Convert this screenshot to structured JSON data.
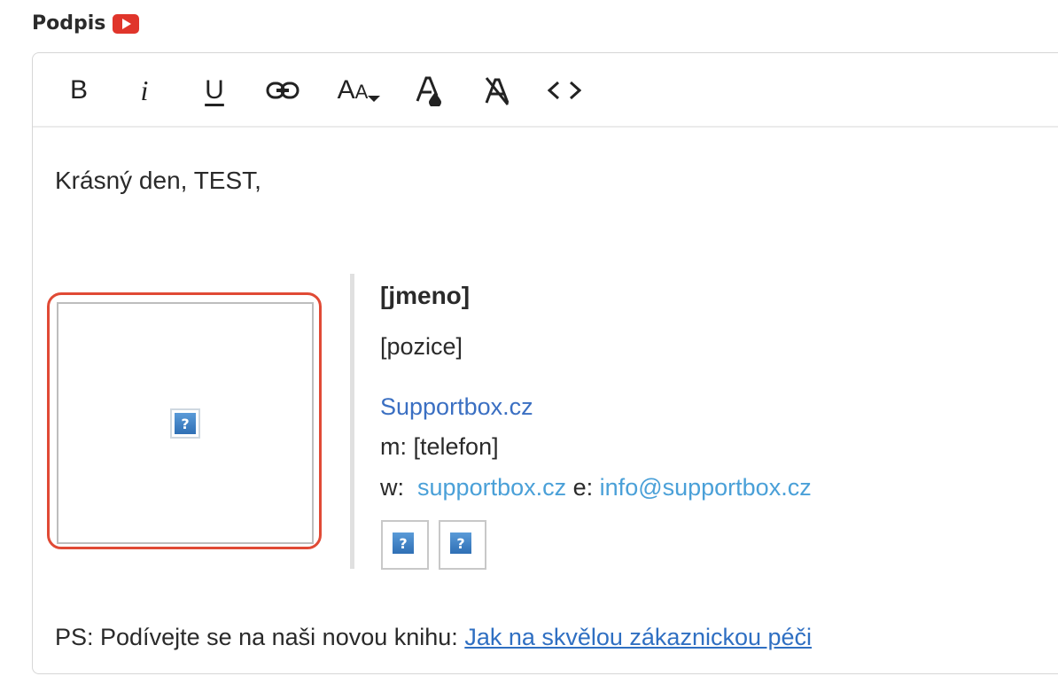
{
  "section": {
    "label": "Podpis",
    "video_icon": "youtube-play-icon"
  },
  "toolbar": {
    "buttons": [
      {
        "name": "bold",
        "label": "B",
        "icon": "bold-icon"
      },
      {
        "name": "italic",
        "label": "i",
        "icon": "italic-icon"
      },
      {
        "name": "underline",
        "label": "U",
        "icon": "underline-icon"
      },
      {
        "name": "link",
        "label": "",
        "icon": "link-icon"
      },
      {
        "name": "font-size",
        "label": "AA",
        "icon": "font-size-icon"
      },
      {
        "name": "text-color",
        "label": "A",
        "icon": "text-color-icon"
      },
      {
        "name": "clear-format",
        "label": "A",
        "icon": "clear-format-icon"
      },
      {
        "name": "code-view",
        "label": "<>",
        "icon": "code-icon"
      }
    ]
  },
  "content": {
    "greeting": "Krásný den, TEST,",
    "signature": {
      "name": "[jmeno]",
      "position": "[pozice]",
      "site_link": "Supportbox.cz",
      "m_label": "m:",
      "m_value": "[telefon]",
      "w_label": "w:",
      "w_link": "supportbox.cz",
      "e_label": "e:",
      "e_link": "info@supportbox.cz"
    },
    "ps_text": "PS: Podívejte se na naši novou knihu:",
    "ps_link": "Jak na skvělou zákaznickou péči"
  },
  "colors": {
    "highlight_frame": "#e04a35",
    "link": "#3a6fc2",
    "link_light": "#4aa0d8"
  }
}
